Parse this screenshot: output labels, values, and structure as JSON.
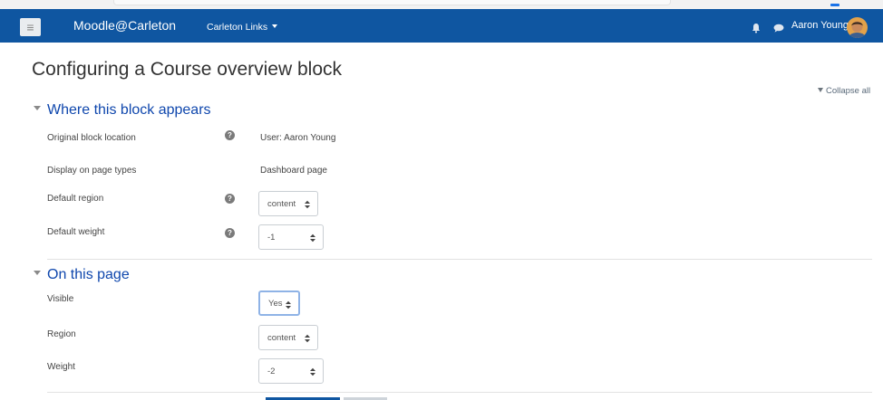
{
  "navbar": {
    "menu_icon": "hamburger-icon",
    "brand": "Moodle@Carleton",
    "links_label": "Carleton Links",
    "notifications_icon": "bell-icon",
    "messages_icon": "chat-bubble-icon",
    "user_name": "Aaron Young",
    "color": "#0f56a1"
  },
  "page": {
    "title": "Configuring a Course overview block",
    "collapse_all": "Collapse all"
  },
  "where_section": {
    "heading": "Where this block appears",
    "original_location_label": "Original block location",
    "original_location_value": "User: Aaron Young",
    "display_page_types_label": "Display on page types",
    "display_page_types_value": "Dashboard page",
    "default_region_label": "Default region",
    "default_region_value": "content",
    "default_weight_label": "Default weight",
    "default_weight_value": "-1"
  },
  "on_page_section": {
    "heading": "On this page",
    "visible_label": "Visible",
    "visible_value": "Yes",
    "region_label": "Region",
    "region_value": "content",
    "weight_label": "Weight",
    "weight_value": "-2"
  }
}
